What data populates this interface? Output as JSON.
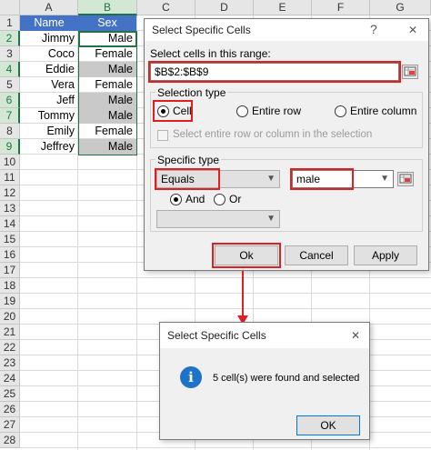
{
  "spreadsheet": {
    "columns": [
      "A",
      "B",
      "C",
      "D",
      "E",
      "F",
      "G"
    ],
    "rows": [
      "1",
      "2",
      "3",
      "4",
      "5",
      "6",
      "7",
      "8",
      "9",
      "10",
      "11",
      "12",
      "13",
      "14",
      "15",
      "16",
      "17",
      "18",
      "19",
      "20",
      "21",
      "22",
      "23",
      "24",
      "25",
      "26",
      "27",
      "28"
    ],
    "header": {
      "name": "Name",
      "sex": "Sex"
    },
    "data": [
      {
        "name": "Jimmy",
        "sex": "Male"
      },
      {
        "name": "Coco",
        "sex": "Female"
      },
      {
        "name": "Eddie",
        "sex": "Male"
      },
      {
        "name": "Vera",
        "sex": "Female"
      },
      {
        "name": "Jeff",
        "sex": "Male"
      },
      {
        "name": "Tommy",
        "sex": "Male"
      },
      {
        "name": "Emily",
        "sex": "Female"
      },
      {
        "name": "Jeffrey",
        "sex": "Male"
      }
    ],
    "colors": {
      "header_fill": "#4472c4",
      "highlight_fill": "#c9c9c9",
      "selection": "#217346"
    }
  },
  "dialog_main": {
    "title": "Select Specific Cells",
    "help_glyph": "?",
    "close_glyph": "✕",
    "range_label": "Select cells in this range:",
    "range_value": "$B$2:$B$9",
    "selection_type_label": "Selection type",
    "opt_cell": "Cell",
    "opt_entire_row": "Entire row",
    "opt_entire_column": "Entire column",
    "select_entire_label": "Select entire row or column in the selection",
    "specific_type_label": "Specific type",
    "condition1": "Equals",
    "value1": "male",
    "opt_and": "And",
    "opt_or": "Or",
    "condition2": "",
    "ok": "Ok",
    "cancel": "Cancel",
    "apply": "Apply"
  },
  "dialog_result": {
    "title": "Select Specific Cells",
    "close_glyph": "✕",
    "icon": "info-icon",
    "message": "5 cell(s) were found and selected",
    "ok": "OK"
  },
  "annotation_color": "#e02020"
}
